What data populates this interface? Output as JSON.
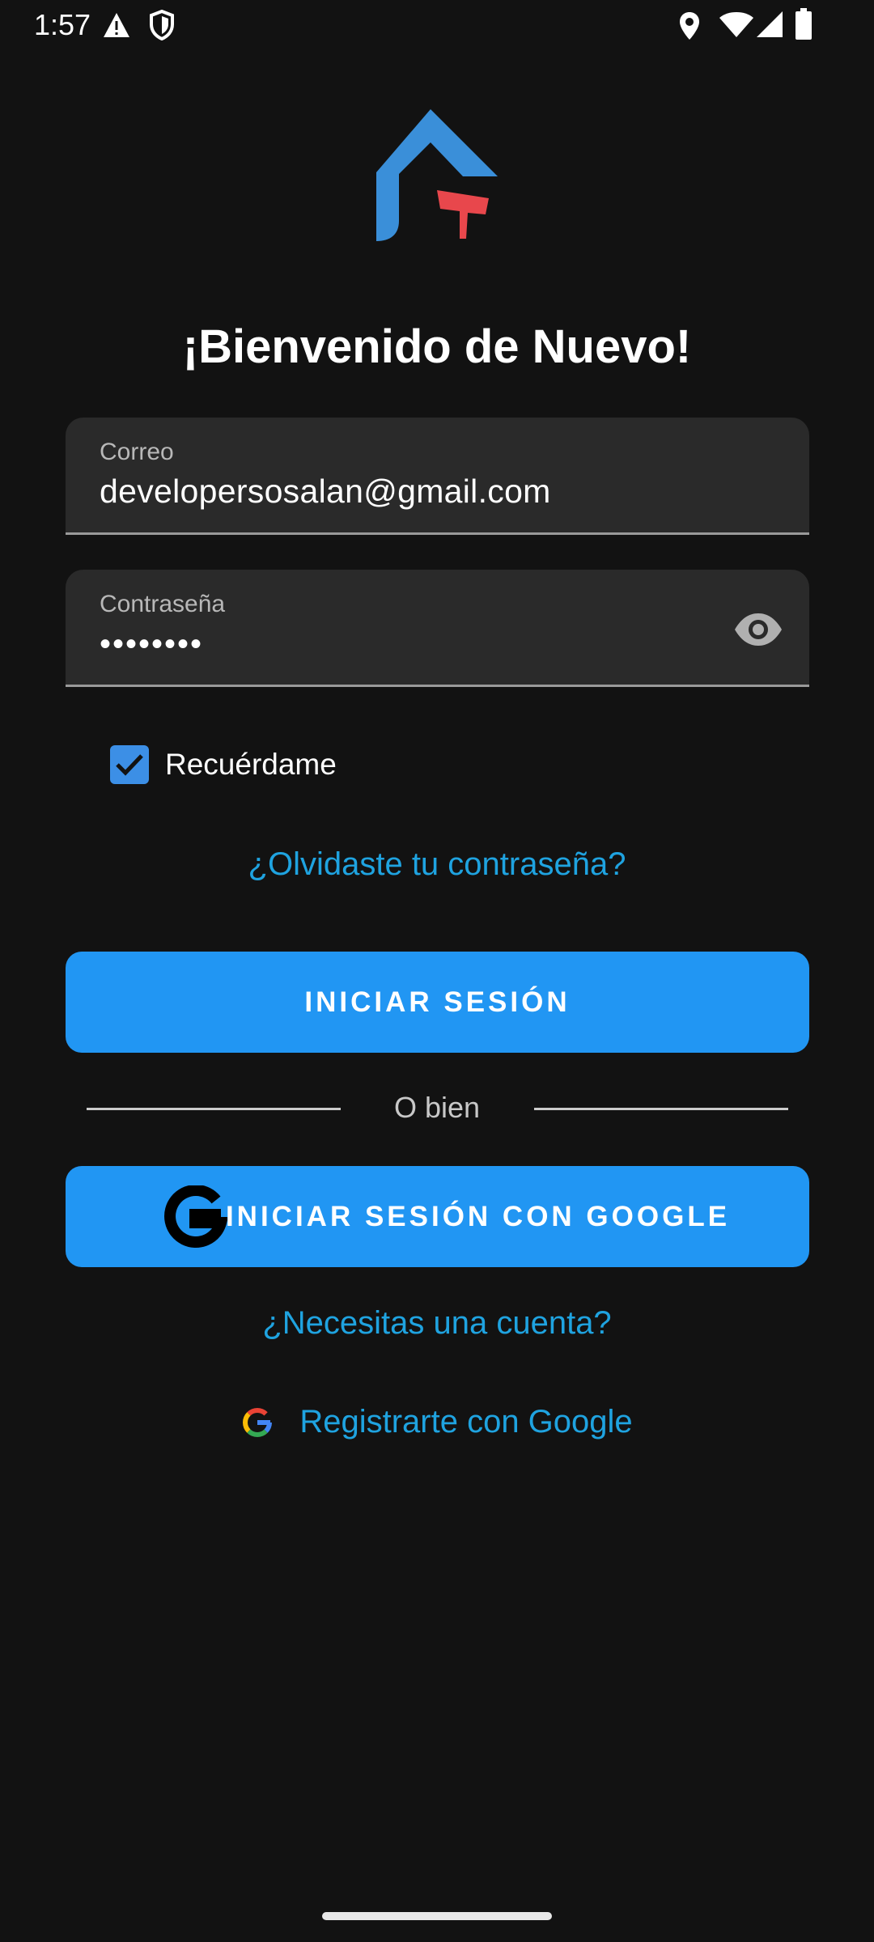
{
  "status_bar": {
    "time": "1:57",
    "icons": [
      "warning-icon",
      "shield-icon",
      "location-icon",
      "wifi-icon",
      "signal-icon",
      "battery-icon"
    ]
  },
  "logo": {
    "icon": "house-with-flag-logo",
    "colors": {
      "house": "#3a8fd9",
      "flag": "#e8474c"
    }
  },
  "title": "¡Bienvenido de Nuevo!",
  "email": {
    "label": "Correo",
    "value": "developersosalan@gmail.com"
  },
  "password": {
    "label": "Contraseña",
    "value": "••••••••",
    "toggle_icon": "eye-icon"
  },
  "remember": {
    "label": "Recuérdame",
    "checked": true
  },
  "forgot_link": "¿Olvidaste tu contraseña?",
  "login_button": "INICIAR SESIÓN",
  "divider_text": "O bien",
  "google_button": "INICIAR SESIÓN CON GOOGLE",
  "need_account_link": "¿Necesitas una cuenta?",
  "register_google": "Registrarte con Google",
  "colors": {
    "accent": "#2196f3",
    "link": "#1fa3e0",
    "background": "#121212",
    "field": "#2a2a2a"
  }
}
